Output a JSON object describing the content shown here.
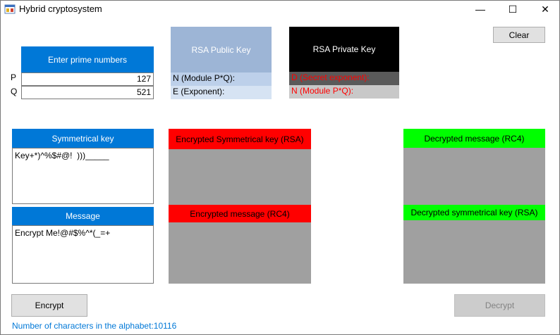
{
  "window": {
    "title": "Hybrid cryptosystem",
    "minimize_glyph": "—",
    "maximize_glyph": "☐",
    "close_glyph": "✕"
  },
  "toolbar": {
    "clear_label": "Clear",
    "encrypt_label": "Encrypt",
    "decrypt_label": "Decrypt"
  },
  "primes": {
    "header": "Enter prime numbers",
    "p_label": "P",
    "q_label": "Q",
    "p_value": "127",
    "q_value": "521"
  },
  "public_key": {
    "header": "RSA Public Key",
    "n_label": "N (Module P*Q):",
    "e_label": "E (Exponent):"
  },
  "private_key": {
    "header": "RSA Private Key",
    "d_label": "D (Secret exponent):",
    "n_label": "N (Module P*Q):"
  },
  "symmetric_key": {
    "header": "Symmetrical key",
    "value": "Key+*)^%$#@!  )))_____"
  },
  "message": {
    "header": "Message",
    "value": "Encrypt Me!@#$%^*(_=+"
  },
  "encrypted": {
    "sym_key_header": "Encrypted Symmetrical key (RSA)",
    "message_header": "Encrypted message (RC4)"
  },
  "decrypted": {
    "message_header": "Decrypted message (RC4)",
    "sym_key_header": "Decrypted symmetrical key (RSA)"
  },
  "status": {
    "alphabet_text": "Number of characters in the alphabet:10116"
  },
  "colors": {
    "accent_blue": "#0078d7",
    "public_key_bg": "#9db5d6",
    "private_key_bg": "#000000",
    "red": "#ff0000",
    "green": "#00ff00",
    "gray": "#a0a0a0",
    "status_text": "#0078d7"
  }
}
